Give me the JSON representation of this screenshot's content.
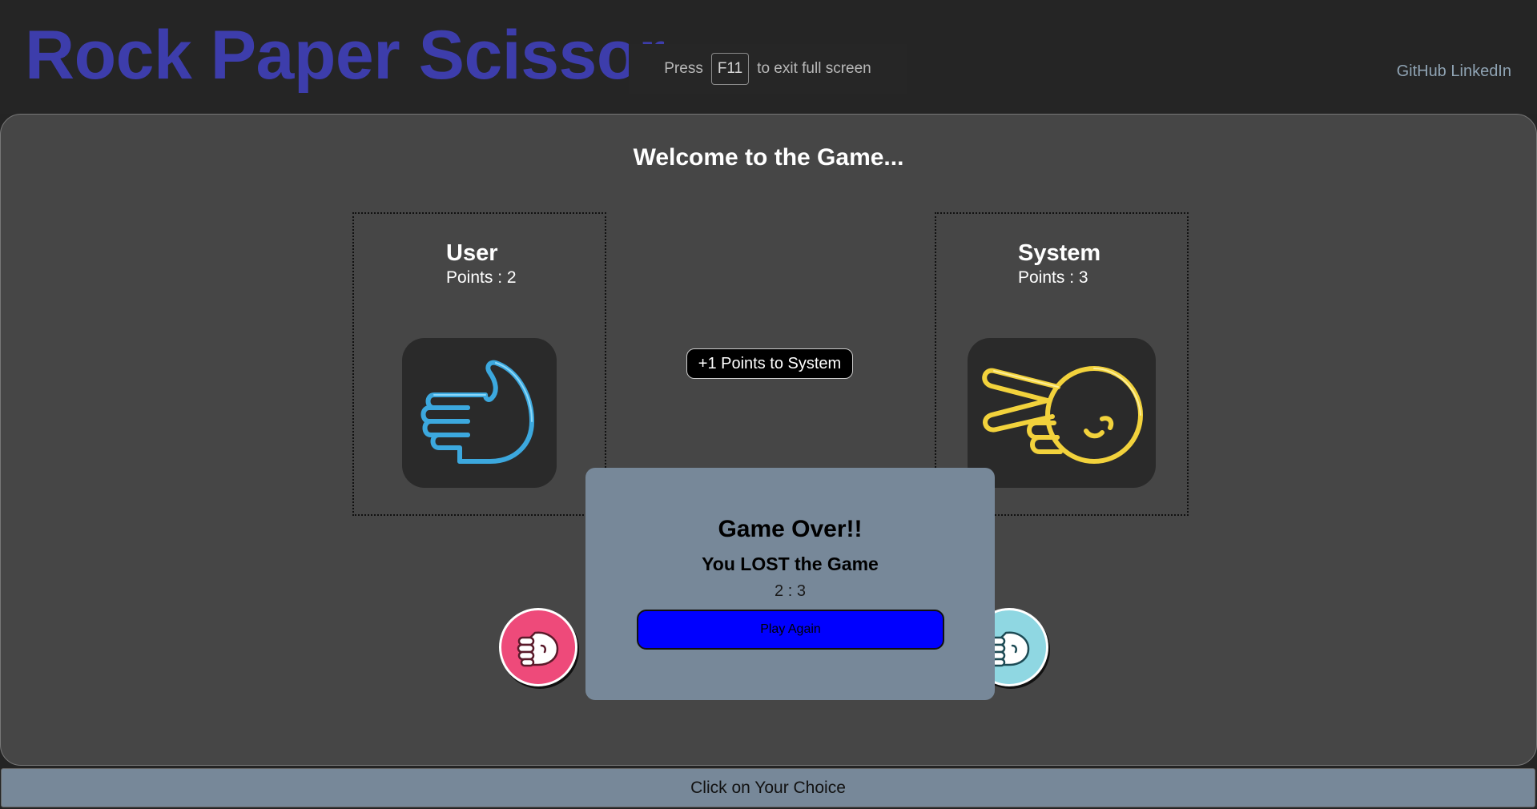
{
  "header": {
    "title": "Rock Paper Scissor",
    "links": [
      "GitHub",
      "LinkedIn"
    ]
  },
  "fullscreen_toast": {
    "prefix": "Press",
    "key": "F11",
    "suffix": "to exit full screen"
  },
  "game": {
    "welcome": "Welcome to the Game...",
    "user": {
      "name": "User",
      "points_label": "Points : 2",
      "choice_icon": "paper-hand-icon"
    },
    "system": {
      "name": "System",
      "points_label": "Points : 3",
      "choice_icon": "scissors-hand-icon"
    },
    "round_result": "+1 Points to System",
    "choices": [
      {
        "id": "rock",
        "icon": "rock-fist-icon",
        "color": "#ee4a7a"
      },
      {
        "id": "paper",
        "icon": "rock-fist-icon",
        "color": "#8fd7e2"
      }
    ]
  },
  "game_over": {
    "title": "Game Over!!",
    "result": "You LOST the Game",
    "score": "2 : 3",
    "button": "Play Again"
  },
  "footer": {
    "instruction": "Click on Your Choice"
  },
  "colors": {
    "title": "#3d3dab",
    "panel": "#464646",
    "overlay": "#778899",
    "play_button": "#0000ff",
    "user_neon": "#3fb6f2",
    "system_neon": "#f2d23c"
  }
}
